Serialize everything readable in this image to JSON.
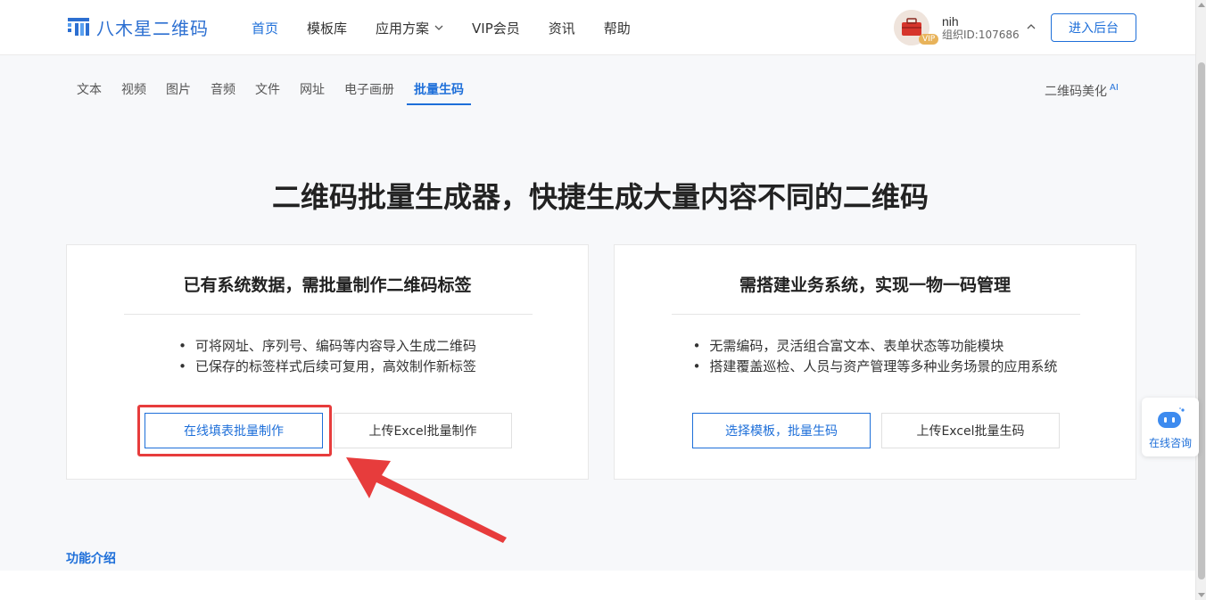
{
  "header": {
    "logo_text": "八木星二维码",
    "nav": [
      {
        "label": "首页",
        "active": true
      },
      {
        "label": "模板库",
        "active": false
      },
      {
        "label": "应用方案",
        "active": false,
        "dropdown": true
      },
      {
        "label": "VIP会员",
        "active": false
      },
      {
        "label": "资讯",
        "active": false
      },
      {
        "label": "帮助",
        "active": false
      }
    ],
    "user": {
      "name": "nih",
      "org": "组织ID:107686",
      "vip_label": "VIP"
    },
    "enter_button": "进入后台"
  },
  "subtabs": [
    {
      "label": "文本",
      "active": false
    },
    {
      "label": "视频",
      "active": false
    },
    {
      "label": "图片",
      "active": false
    },
    {
      "label": "音频",
      "active": false
    },
    {
      "label": "文件",
      "active": false
    },
    {
      "label": "网址",
      "active": false
    },
    {
      "label": "电子画册",
      "active": false
    },
    {
      "label": "批量生码",
      "active": true
    }
  ],
  "beautify": {
    "label": "二维码美化",
    "badge": "AI"
  },
  "hero_title": "二维码批量生成器，快捷生成大量内容不同的二维码",
  "cards": [
    {
      "title": "已有系统数据，需批量制作二维码标签",
      "bullets": [
        "可将网址、序列号、编码等内容导入生成二维码",
        "已保存的标签样式后续可复用，高效制作新标签"
      ],
      "primary_button": "在线填表批量制作",
      "secondary_button": "上传Excel批量制作"
    },
    {
      "title": "需搭建业务系统，实现一物一码管理",
      "bullets": [
        "无需编码，灵活组合富文本、表单状态等功能模块",
        "搭建覆盖巡检、人员与资产管理等多种业务场景的应用系统"
      ],
      "primary_button": "选择模板，批量生码",
      "secondary_button": "上传Excel批量生码"
    }
  ],
  "consult_label": "在线咨询",
  "feature_tab": "功能介绍",
  "colors": {
    "accent": "#1e6fd9",
    "highlight": "#e73c3c",
    "vip": "#e8b35a"
  }
}
